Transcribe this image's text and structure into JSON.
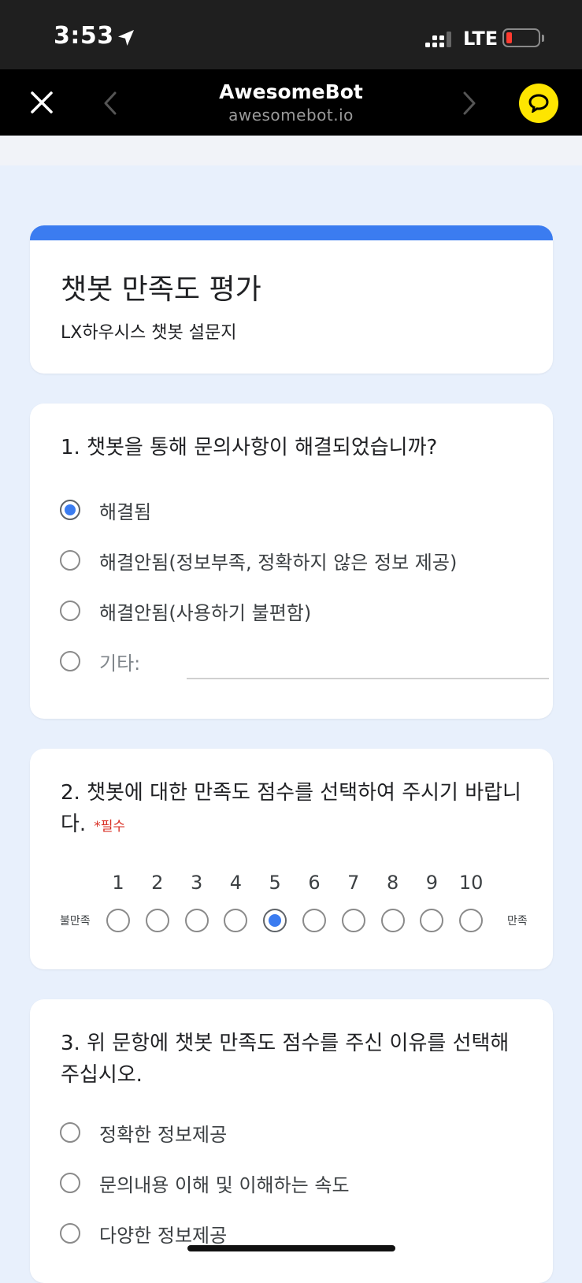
{
  "status_bar": {
    "time": "3:53",
    "network": "LTE"
  },
  "browser": {
    "title": "AwesomeBot",
    "url": "awesomebot.io",
    "icons": [
      "close-icon",
      "back-chevron-icon",
      "forward-chevron-icon",
      "chat-bubble-icon"
    ]
  },
  "form": {
    "title": "챗봇 만족도 평가",
    "description": "LX하우시스 챗봇 설문지"
  },
  "question1": {
    "title": "1. 챗봇을 통해 문의사항이 해결되었습니까?",
    "options": [
      {
        "label": "해결됨",
        "checked": true
      },
      {
        "label": "해결안됨(정보부족, 정확하지 않은 정보 제공)",
        "checked": false
      },
      {
        "label": "해결안됨(사용하기 불편함)",
        "checked": false
      },
      {
        "label": "기타:",
        "checked": false
      }
    ]
  },
  "question2": {
    "title": "2. 챗봇에 대한 만족도 점수를 선택하여 주시기 바랍니다.",
    "required_label": "*필수",
    "min_label": "불만족",
    "max_label": "만족",
    "scale": [
      "1",
      "2",
      "3",
      "4",
      "5",
      "6",
      "7",
      "8",
      "9",
      "10"
    ],
    "selected": "5"
  },
  "question3": {
    "title": "3. 위 문항에 챗봇 만족도 점수를 주신 이유를 선택해 주십시오.",
    "options": [
      {
        "label": "정확한 정보제공",
        "checked": false
      },
      {
        "label": "문의내용 이해 및 이해하는 속도",
        "checked": false
      },
      {
        "label": "다양한 정보제공",
        "checked": false
      }
    ]
  },
  "colors": {
    "accent": "#3b7cf0",
    "background": "#e8f0fc",
    "kakao": "#fee500",
    "required": "#d93025"
  }
}
